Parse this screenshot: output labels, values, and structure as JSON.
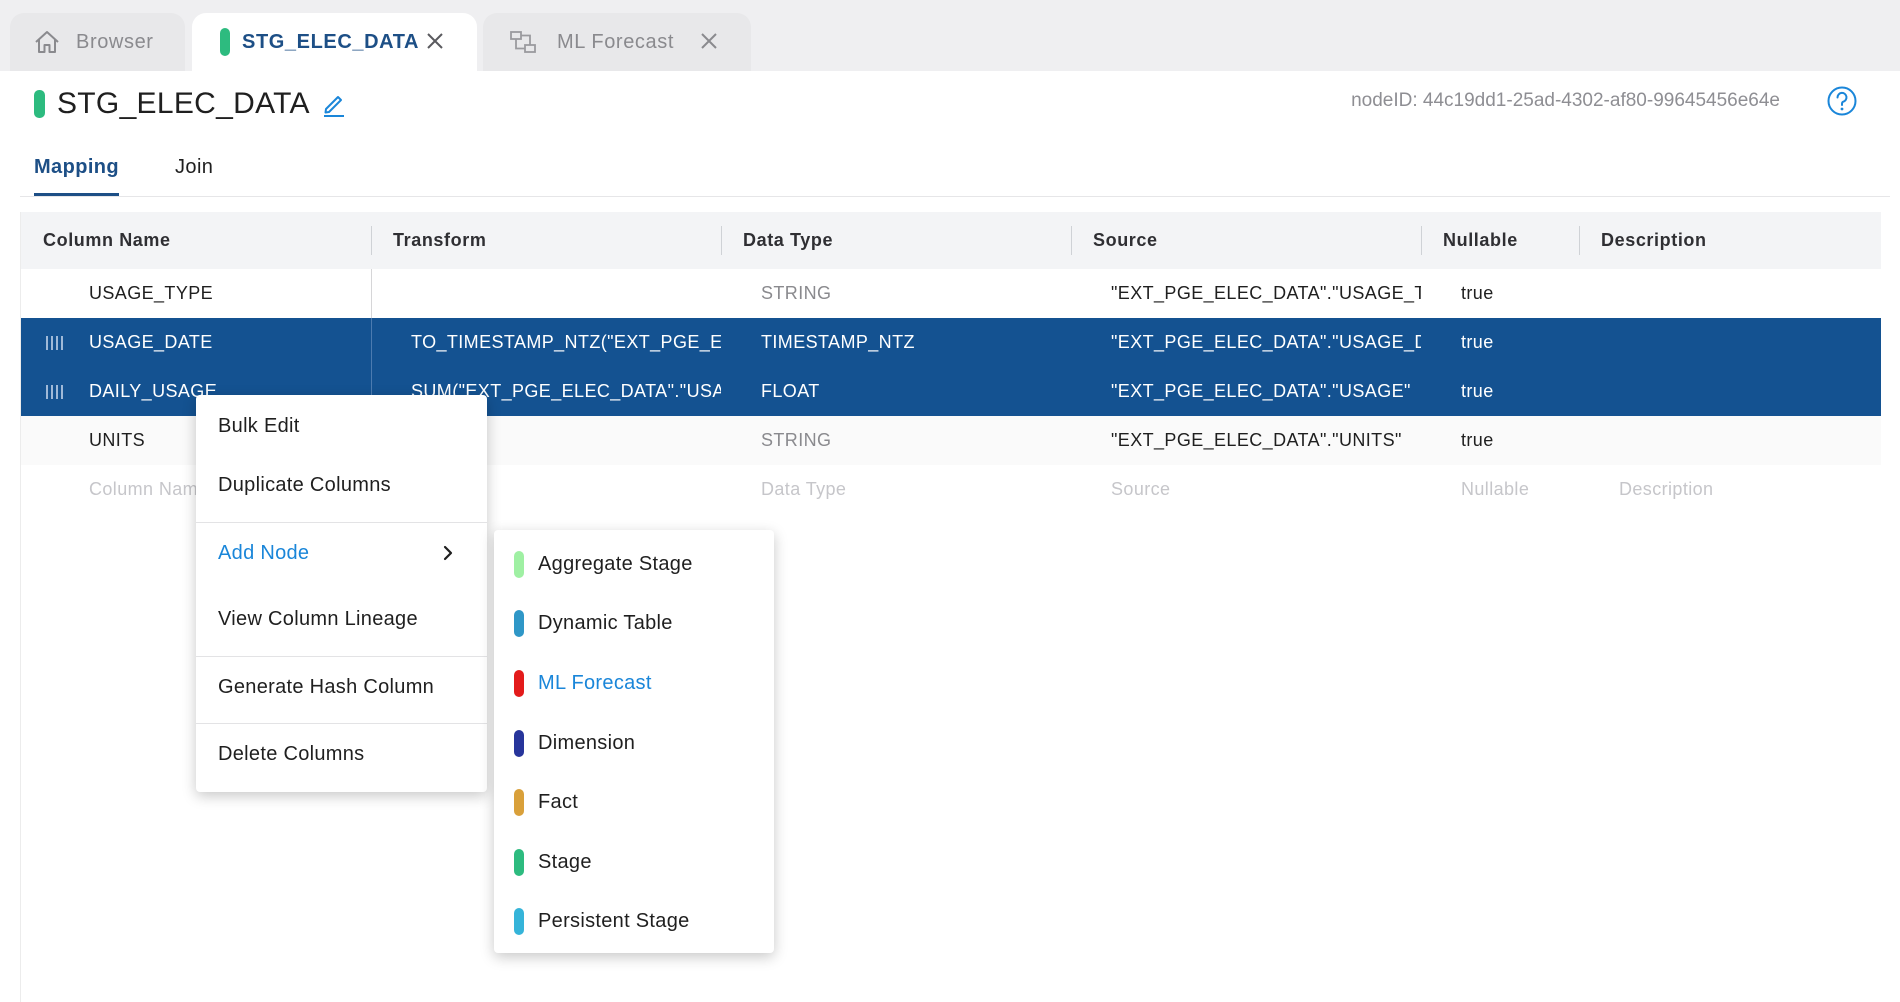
{
  "tabs": [
    {
      "label": "Browser",
      "icon": "home-icon",
      "active": false
    },
    {
      "label": "STG_ELEC_DATA",
      "icon": "node-chip",
      "active": true,
      "color": "#2dbb7f"
    },
    {
      "label": "ML Forecast",
      "icon": "flow-icon",
      "active": false
    }
  ],
  "header": {
    "title": "STG_ELEC_DATA",
    "node_id": "nodeID: 44c19dd1-25ad-4302-af80-99645456e64e"
  },
  "subtabs": [
    {
      "label": "Mapping",
      "active": true
    },
    {
      "label": "Join",
      "active": false
    }
  ],
  "grid": {
    "columns": [
      "Column Name",
      "Transform",
      "Data Type",
      "Source",
      "Nullable",
      "Description"
    ],
    "rows": [
      {
        "name": "USAGE_TYPE",
        "transform": "",
        "type": "STRING",
        "source": "\"EXT_PGE_ELEC_DATA\".\"USAGE_TYP",
        "nullable": "true",
        "description": "",
        "selected": false
      },
      {
        "name": "USAGE_DATE",
        "transform": "TO_TIMESTAMP_NTZ(\"EXT_PGE_ELI",
        "type": "TIMESTAMP_NTZ",
        "source": "\"EXT_PGE_ELEC_DATA\".\"USAGE_DAT",
        "nullable": "true",
        "description": "",
        "selected": true
      },
      {
        "name": "DAILY_USAGE",
        "transform": "SUM(\"EXT_PGE_ELEC_DATA\".\"USAGE",
        "type": "FLOAT",
        "source": "\"EXT_PGE_ELEC_DATA\".\"USAGE\"",
        "nullable": "true",
        "description": "",
        "selected": true
      },
      {
        "name": "UNITS",
        "transform": "",
        "type": "STRING",
        "source": "\"EXT_PGE_ELEC_DATA\".\"UNITS\"",
        "nullable": "true",
        "description": "",
        "selected": false
      }
    ],
    "placeholder": {
      "name": "Column Nam",
      "transform": "m",
      "type": "Data Type",
      "source": "Source",
      "nullable": "Nullable",
      "description": "Description"
    },
    "selected_color": "#145291"
  },
  "context_menu": {
    "items": [
      "Bulk Edit",
      "Duplicate Columns",
      "Add Node",
      "View Column Lineage",
      "Generate Hash Column",
      "Delete Columns"
    ],
    "highlighted": "Add Node"
  },
  "add_node_menu": {
    "items": [
      {
        "label": "Aggregate Stage",
        "color": "#9ff0a3"
      },
      {
        "label": "Dynamic Table",
        "color": "#2f97c7"
      },
      {
        "label": "ML Forecast",
        "color": "#e31b1b",
        "highlight": true
      },
      {
        "label": "Dimension",
        "color": "#27359b"
      },
      {
        "label": "Fact",
        "color": "#d9a03a"
      },
      {
        "label": "Stage",
        "color": "#2dbb7f"
      },
      {
        "label": "Persistent Stage",
        "color": "#35b4d9"
      }
    ]
  },
  "accent": "#1d4f86",
  "link_color": "#1a86d9"
}
